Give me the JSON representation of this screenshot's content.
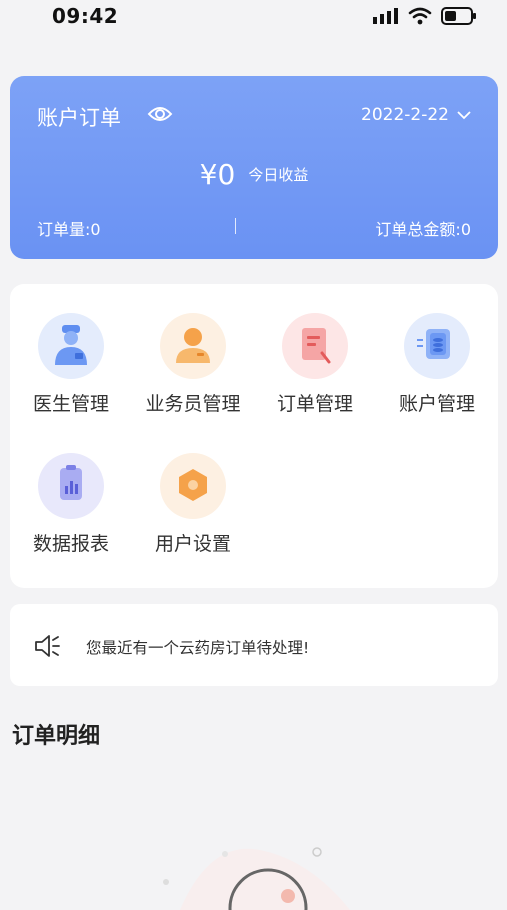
{
  "status_bar": {
    "time": "09:42"
  },
  "account": {
    "title": "账户订单",
    "date": "2022-2-22",
    "amount": "¥0",
    "amount_label": "今日收益",
    "order_count": "订单量:0",
    "order_total": "订单总金额:0"
  },
  "menu": {
    "items": [
      {
        "label": "医生管理",
        "icon": "doctor-icon"
      },
      {
        "label": "业务员管理",
        "icon": "salesperson-icon"
      },
      {
        "label": "订单管理",
        "icon": "order-icon"
      },
      {
        "label": "账户管理",
        "icon": "account-icon"
      },
      {
        "label": "数据报表",
        "icon": "report-icon"
      },
      {
        "label": "用户设置",
        "icon": "settings-icon"
      }
    ]
  },
  "notice": {
    "text": "您最近有一个云药房订单待处理!"
  },
  "section": {
    "title": "订单明细"
  },
  "colors": {
    "accent": "#6f96f4",
    "background": "#f3f3f5"
  }
}
